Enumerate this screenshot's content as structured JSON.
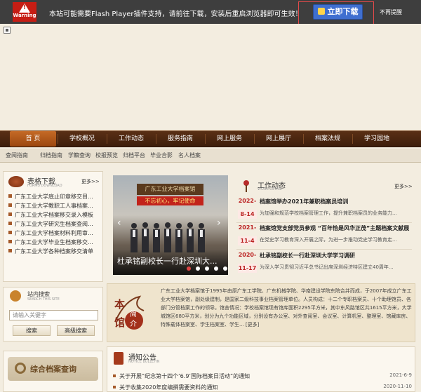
{
  "flash_bar": {
    "warning_label": "Warning",
    "message": "本站可能需要Flash Player插件支持，请前往下载，安装后重启浏览器即可生效！",
    "download_button": "立即下载",
    "dont_remind": "不再提醒"
  },
  "main_nav": [
    "首 页",
    "学校概况",
    "工作动态",
    "服务指南",
    "网上服务",
    "网上展厅",
    "档案法规",
    "学习园地"
  ],
  "sub_nav": [
    "查阅指南",
    "归档指南",
    "学籍查询",
    "校报预览",
    "归档平台",
    "毕业合影",
    "名人档案"
  ],
  "forms_download": {
    "title": "表格下载",
    "subtitle": "FORMS DOWNLOAD",
    "more": "更多>>",
    "items": [
      "广东工业大学底止印章移交目...",
      "广东工业大学教职工人事档案...",
      "广东工业大学档案移交录入模板",
      "广东工业大学研究生档案查阅...",
      "广东工业大学档案材料利用审...",
      "广东工业大学毕业生档案移交...",
      "广东工业大学各种档案移交清单"
    ]
  },
  "slider": {
    "sign_text": "广东工业大学档案馆",
    "banner_text": "不忘初心，牢记使命",
    "caption": "杜承铭副校长一行赴深圳大...",
    "prev": "‹",
    "next": "›",
    "active_dot": 0,
    "dot_count": 5
  },
  "work_news": {
    "title": "工作动态",
    "subtitle": "WORK DETAIL",
    "more": "更多>>",
    "items": [
      {
        "year": "2022-",
        "day": "8-14",
        "title": "档案馆举办2021年兼职档案员培训",
        "desc": "为加强和规范学校档案管理工作，提升兼职档案员的业务能力..."
      },
      {
        "year": "2021-",
        "day": "11-4",
        "title": "档案馆党支部党员参观 “百年恰是风华正茂”主题档案文献展",
        "desc": "在党史学习教育深入开展之际，为进一步推动党史学习教育走..."
      },
      {
        "year": "2020-",
        "day": "11-17",
        "title": "杜承铭副校长一行赴深圳大学学习调研",
        "desc": "为深入学习贯彻习近平总书记出席深圳经济特区建立40周年..."
      }
    ]
  },
  "intro": {
    "seal_chars": "本馆简介",
    "text": "广东工业大学档案馆于1995年由原广东工学院、广东机械学院、华南建设学院东院合并而成，于2007年成立广东工业大学档案馆，副处级建制，是国家二级科技事业档案管理单位。人员构成：十二个专职档案员、十个助理馆员、各部门分管档案工作的领导。馆舍情况：学校档案馆现有馆库面积2295平方米，其中东风路馆区共1615平方米，大学城馆区680平方米，划分为九个功能区域，分别设有办公室、对外查阅室、会议室、计算机室、整理室、馆藏库房、特殊载体档案室、学生档案室、学生..."
  },
  "intro_more": "[更多]",
  "site_search": {
    "title": "站内搜索",
    "subtitle": "SEARCH THIS SITE",
    "placeholder": "请输入关键字",
    "search_btn": "搜索",
    "advanced_btn": "高级搜索"
  },
  "comprehensive_search": "综合档案查询",
  "notice": {
    "title": "通知公告",
    "subtitle": "NOTICE BULLETIN",
    "items": [
      {
        "text": "关于开展“纪念第十四个‘6.9’国际档案日活动”的通知",
        "date": "2021-6-9"
      },
      {
        "text": "关于收集2020年度编撰需要资料的通知",
        "date": "2020-11-10"
      }
    ]
  },
  "colors": {
    "nav_dark": "#4a250e",
    "nav_active": "#c46a26",
    "accent_red": "#b22222",
    "download_blue": "#3f6fd0",
    "highlight_box": "#e34a4a"
  }
}
